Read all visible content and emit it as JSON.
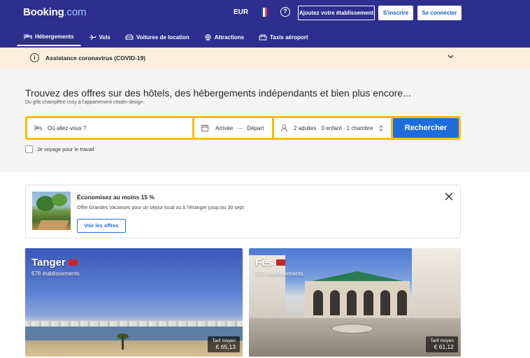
{
  "header": {
    "logo_main": "Booking",
    "logo_suffix": ".com",
    "currency": "EUR",
    "help": "?",
    "list_property": "Ajoutez votre établissement",
    "register": "S'inscrire",
    "sign_in": "Se connecter",
    "flag_colors": [
      "#0055a4",
      "#ffffff",
      "#ef4135"
    ]
  },
  "nav": [
    {
      "label": "Hébergements",
      "icon": "bed-icon",
      "active": true
    },
    {
      "label": "Vols",
      "icon": "plane-icon",
      "active": false
    },
    {
      "label": "Voitures de location",
      "icon": "car-icon",
      "active": false
    },
    {
      "label": "Attractions",
      "icon": "attractions-icon",
      "active": false
    },
    {
      "label": "Taxis aéroport",
      "icon": "taxi-icon",
      "active": false
    }
  ],
  "covid": {
    "text": "Assistance coronavirus (COVID-19)",
    "info_icon": "i"
  },
  "hero": {
    "title": "Trouvez des offres sur des hôtels, des hébergements indépendants et bien plus encore...",
    "subtitle": "Du gîte champêtre cosy à l'appartement citadin design",
    "destination_placeholder": "Où allez-vous ?",
    "checkin": "Arrivée",
    "dash": "—",
    "checkout": "Départ",
    "guests": "2 adultes · 0 enfant · 1 chambre",
    "search_button": "Rechercher",
    "work_travel": "Je voyage pour le travail",
    "search_accent": "#febb02",
    "brand_blue": "#1f6ddb"
  },
  "promo": {
    "title": "Économisez au moins 15 %",
    "description": "Offre Grandes Vacances pour un séjour local ou à l'étranger jusqu'au 30 sept",
    "button": "Voir les offres"
  },
  "cities": [
    {
      "name": "Tanger",
      "count": "678 établissements",
      "price_label": "Tarif moyen",
      "price": "€ 65,13"
    },
    {
      "name": "Fès",
      "count": "570 établissements",
      "price_label": "Tarif moyen",
      "price": "€ 61,12"
    }
  ]
}
